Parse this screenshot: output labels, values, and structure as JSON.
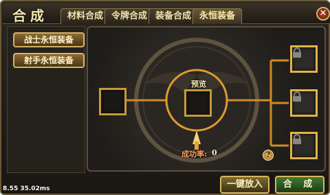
{
  "window": {
    "title": "合成",
    "close_glyph": "✕"
  },
  "tabs": [
    {
      "label": "材料合成",
      "active": false
    },
    {
      "label": "令牌合成",
      "active": false
    },
    {
      "label": "装备合成",
      "active": false
    },
    {
      "label": "永恒装备",
      "active": true
    }
  ],
  "sidebar": {
    "items": [
      {
        "label": "战士永恒装备"
      },
      {
        "label": "射手永恒装备"
      }
    ]
  },
  "stage": {
    "preview_label": "预览",
    "success_rate_label": "成功率:",
    "success_rate_value": "0",
    "input_slot": {
      "icon": "empty-slot"
    },
    "locked_slots": [
      {
        "icon": "lock-icon"
      },
      {
        "icon": "lock-icon"
      },
      {
        "icon": "lock-icon"
      }
    ],
    "help_glyph": "?"
  },
  "buttons": {
    "one_key_insert": "一键放入",
    "synthesize": "合 成"
  },
  "debug": {
    "fps_text": "8.55   35.02ms"
  },
  "colors": {
    "gold": "#d9b85e",
    "accent_orange": "#d08a2a",
    "rate_red": "#ff9a5a",
    "rate_value": "#f8f0c8"
  }
}
